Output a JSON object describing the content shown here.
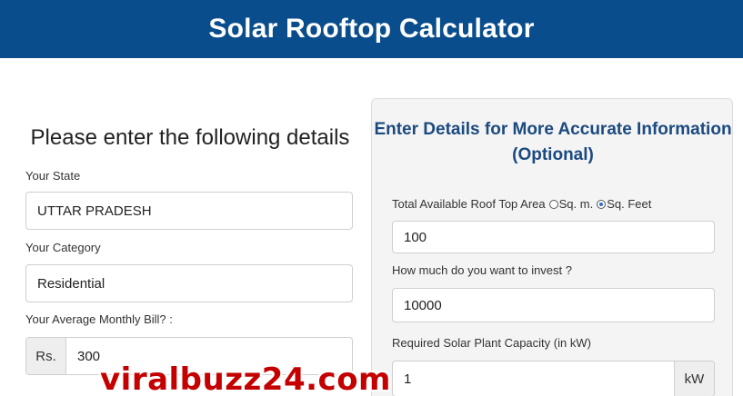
{
  "header": {
    "title": "Solar Rooftop Calculator"
  },
  "left": {
    "title": "Please enter the following details",
    "state": {
      "label": "Your State",
      "value": "UTTAR PRADESH"
    },
    "category": {
      "label": "Your Category",
      "value": "Residential"
    },
    "bill": {
      "label": "Your Average Monthly Bill? :",
      "prefix": "Rs.",
      "value": "300"
    }
  },
  "panel": {
    "title_line1": "Enter Details for More Accurate Information",
    "title_line2": "(Optional)",
    "roof": {
      "label": "Total Available Roof Top Area",
      "unit_sqm": "Sq. m.",
      "unit_sqft": "Sq. Feet",
      "selected_unit": "Sq. Feet",
      "value": "100"
    },
    "invest": {
      "label": "How much do you want to invest ?",
      "value": "10000"
    },
    "capacity": {
      "label": "Required Solar Plant Capacity (in kW)",
      "value": "1",
      "suffix": "kW"
    }
  },
  "watermark": "viralbuzz24.com",
  "colors": {
    "header_bg": "#0a4d8c",
    "panel_title": "#1b4a80",
    "watermark": "#c40000"
  }
}
